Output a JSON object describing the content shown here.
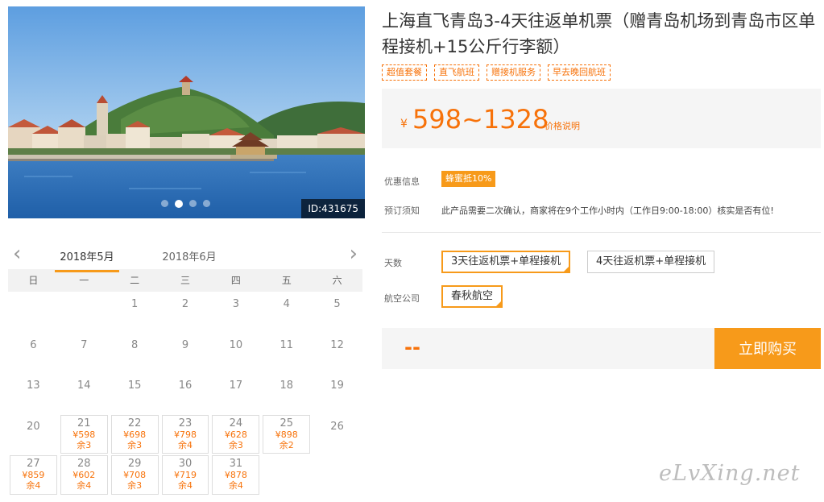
{
  "photo": {
    "id_label": "ID:431675",
    "dot_count": 4,
    "active_dot": 1
  },
  "product": {
    "title": "上海直飞青岛3-4天往返单机票（赠青岛机场到青岛市区单程接机+15公斤行李额）",
    "tags": [
      "超值套餐",
      "直飞航班",
      "赠接机服务",
      "早去晚回航班"
    ],
    "price_currency": "¥",
    "price_range": "598~1328",
    "price_note": "价格说明"
  },
  "promo": {
    "label": "优惠信息",
    "badge": "蜂蜜抵10%"
  },
  "notice": {
    "label": "预订须知",
    "text": "此产品需要二次确认，商家将在9个工作小时内（工作日9:00-18:00）核实是否有位!"
  },
  "options": {
    "days_label": "天数",
    "days": [
      {
        "label": "3天往返机票+单程接机",
        "selected": true
      },
      {
        "label": "4天往返机票+单程接机",
        "selected": false
      }
    ],
    "airline_label": "航空公司",
    "airlines": [
      {
        "label": "春秋航空",
        "selected": true
      }
    ]
  },
  "purchase": {
    "total": "--",
    "button": "立即购买"
  },
  "calendar": {
    "months": [
      "2018年5月",
      "2018年6月"
    ],
    "active_month": 0,
    "weekdays": [
      "日",
      "一",
      "二",
      "三",
      "四",
      "五",
      "六"
    ],
    "weeks": [
      [
        null,
        null,
        {
          "day": "1"
        },
        {
          "day": "2"
        },
        {
          "day": "3"
        },
        {
          "day": "4"
        },
        {
          "day": "5"
        }
      ],
      [
        {
          "day": "6"
        },
        {
          "day": "7"
        },
        {
          "day": "8"
        },
        {
          "day": "9"
        },
        {
          "day": "10"
        },
        {
          "day": "11"
        },
        {
          "day": "12"
        }
      ],
      [
        {
          "day": "13"
        },
        {
          "day": "14"
        },
        {
          "day": "15"
        },
        {
          "day": "16"
        },
        {
          "day": "17"
        },
        {
          "day": "18"
        },
        {
          "day": "19"
        }
      ],
      [
        {
          "day": "20"
        },
        {
          "day": "21",
          "price": "¥598",
          "stock": "余3"
        },
        {
          "day": "22",
          "price": "¥698",
          "stock": "余3"
        },
        {
          "day": "23",
          "price": "¥798",
          "stock": "余4"
        },
        {
          "day": "24",
          "price": "¥628",
          "stock": "余3"
        },
        {
          "day": "25",
          "price": "¥898",
          "stock": "余2"
        },
        {
          "day": "26"
        }
      ],
      [
        {
          "day": "27",
          "price": "¥859",
          "stock": "余4"
        },
        {
          "day": "28",
          "price": "¥602",
          "stock": "余4"
        },
        {
          "day": "29",
          "price": "¥708",
          "stock": "余3"
        },
        {
          "day": "30",
          "price": "¥719",
          "stock": "余4"
        },
        {
          "day": "31",
          "price": "¥878",
          "stock": "余4"
        },
        null,
        null
      ]
    ]
  },
  "watermark": "eLvXing.net",
  "colors": {
    "accent": "#f79a1a",
    "price": "#f7720a"
  }
}
